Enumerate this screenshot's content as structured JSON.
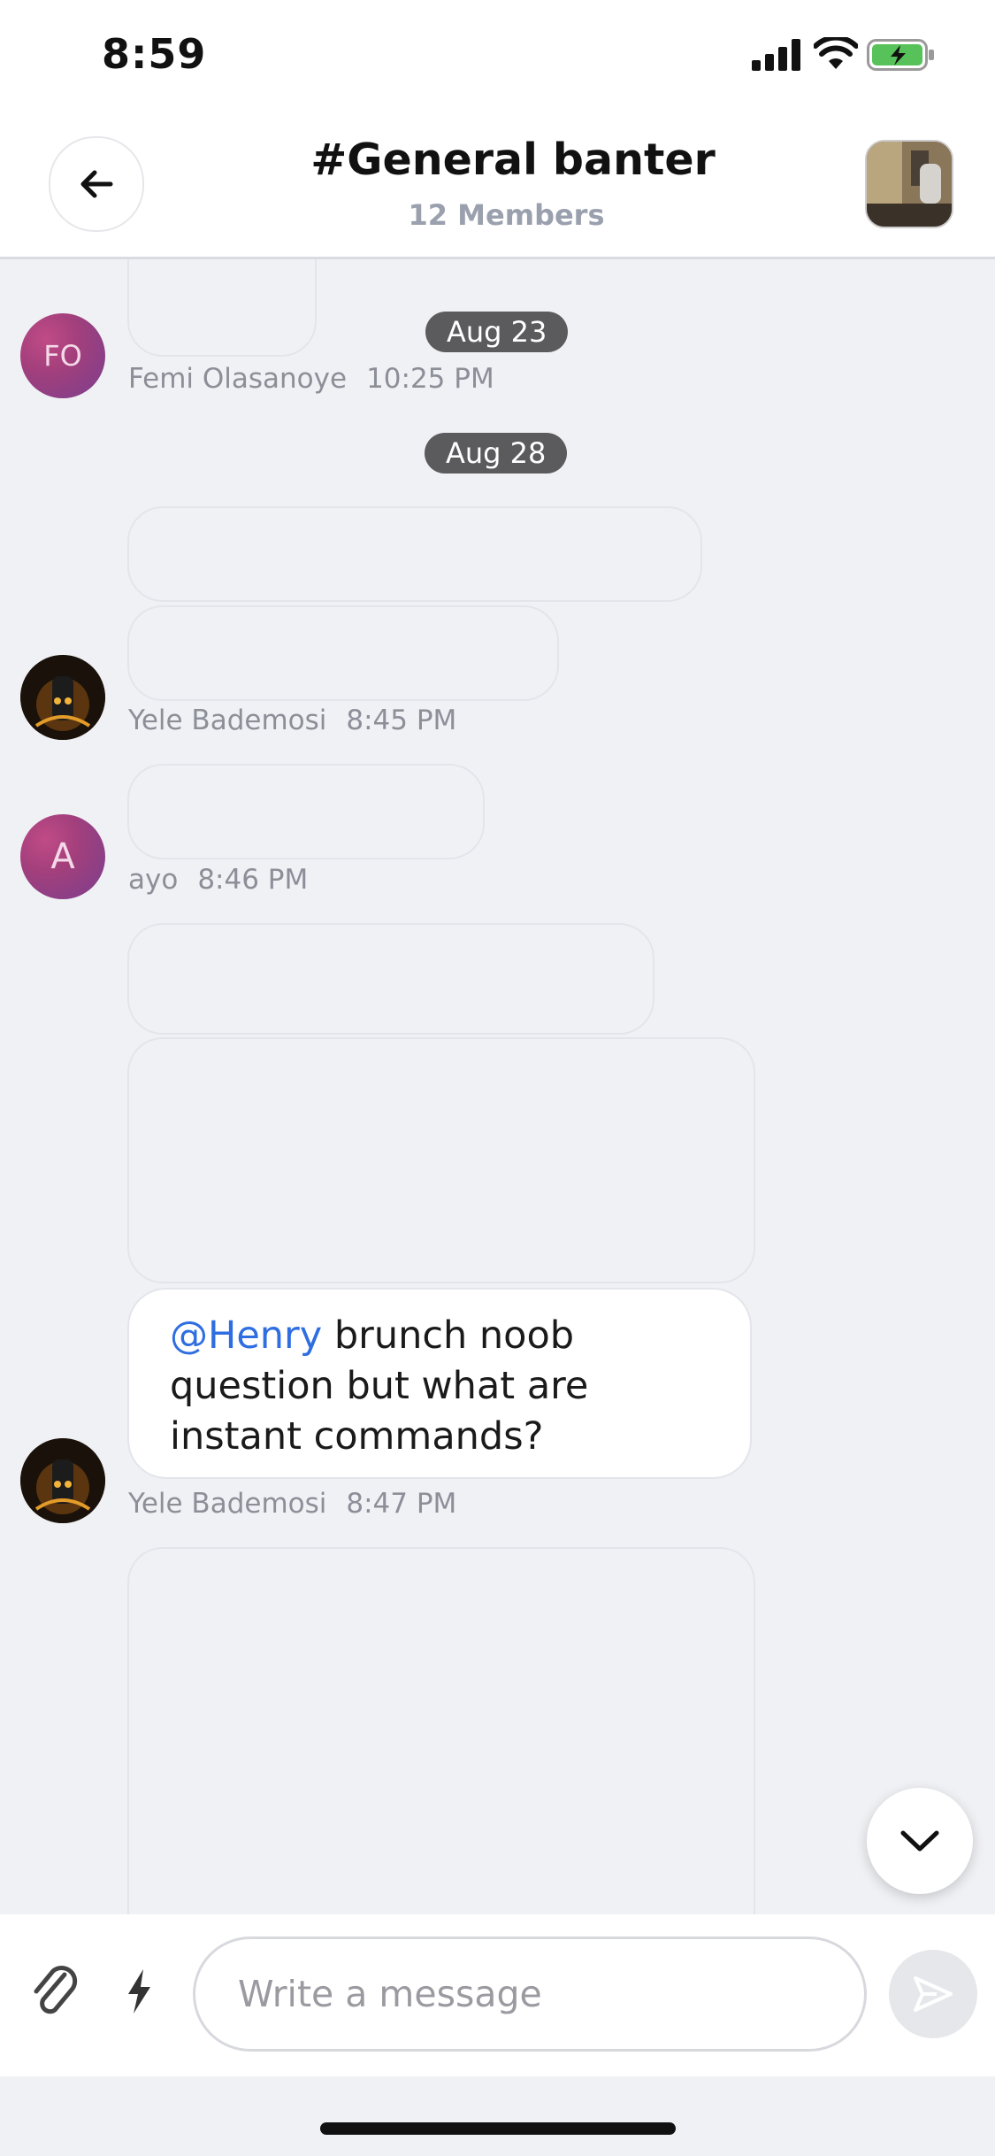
{
  "status_bar": {
    "time": "8:59"
  },
  "header": {
    "title": "#General banter",
    "subtitle": "12 Members"
  },
  "dates": [
    "Aug 23",
    "Aug 28"
  ],
  "messages": {
    "femi": {
      "avatar_initials": "FO",
      "author": "Femi Olasanoye",
      "time": "10:25 PM"
    },
    "yele1": {
      "author": "Yele Bademosi",
      "time": "8:45 PM"
    },
    "ayo": {
      "avatar_initials": "A",
      "author": "ayo",
      "time": "8:46 PM"
    },
    "yele2": {
      "author": "Yele Bademosi",
      "time": "8:47 PM",
      "mention": "@Henry",
      "text": " brunch noob question but what are instant commands?"
    }
  },
  "composer": {
    "placeholder": "Write a message"
  },
  "colors": {
    "mention": "#2f6ee0",
    "date_pill": "#5b5b5d",
    "background": "#f0f1f5"
  }
}
